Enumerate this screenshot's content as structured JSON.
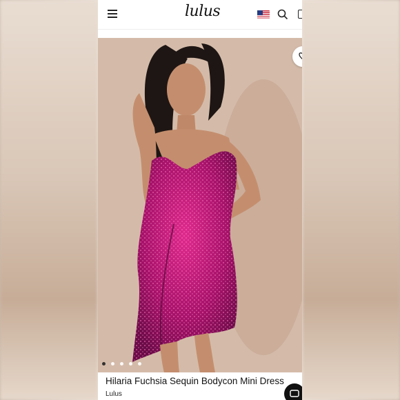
{
  "header": {
    "logo_text": "lulus",
    "menu_icon": "hamburger-menu-icon",
    "flag_icon": "us-flag-icon",
    "search_icon": "search-icon",
    "bag_icon": "shopping-bag-icon"
  },
  "product": {
    "title": "Hilaria Fuchsia Sequin Bodycon Mini Dress",
    "brand": "Lulus",
    "image_description_icon": "product-photo",
    "carousel": {
      "count": 5,
      "active_index": 0
    }
  },
  "colors": {
    "dress": "#b01470",
    "background": "#d2b9a7",
    "text": "#111111"
  }
}
